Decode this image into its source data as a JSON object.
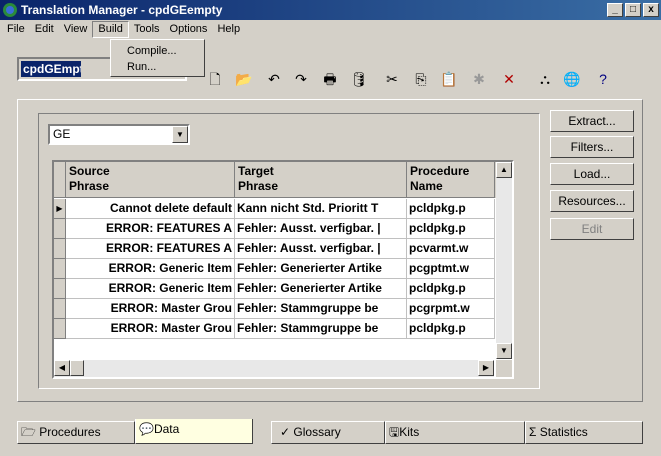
{
  "window": {
    "title": "Translation Manager - cpdGEempty"
  },
  "menu": {
    "file": "File",
    "edit": "Edit",
    "view": "View",
    "build": "Build",
    "tools": "Tools",
    "options": "Options",
    "help": "Help"
  },
  "build_menu": {
    "compile": "Compile...",
    "run": "Run..."
  },
  "toolbar": {
    "file_box": "cpdGEmpty"
  },
  "language_select": {
    "value": "GE"
  },
  "table": {
    "headers": [
      {
        "line1": "Source",
        "line2": "Phrase"
      },
      {
        "line1": "Target",
        "line2": "Phrase"
      },
      {
        "line1": "Procedure",
        "line2": "Name"
      }
    ],
    "rows": [
      {
        "source": "Cannot delete default",
        "target": "Kann nicht Std. Prioritt T",
        "proc": "pcldpkg.p"
      },
      {
        "source": "ERROR: FEATURES A",
        "target": "Fehler: Ausst. verfigbar. |",
        "proc": "pcldpkg.p"
      },
      {
        "source": "ERROR: FEATURES A",
        "target": "Fehler: Ausst. verfigbar. |",
        "proc": "pcvarmt.w"
      },
      {
        "source": "ERROR: Generic Item",
        "target": "Fehler: Generierter Artike",
        "proc": "pcgptmt.w"
      },
      {
        "source": "ERROR: Generic Item",
        "target": "Fehler: Generierter Artike",
        "proc": "pcldpkg.p"
      },
      {
        "source": "ERROR: Master Grou",
        "target": "Fehler: Stammgruppe be",
        "proc": "pcgrpmt.w"
      },
      {
        "source": "ERROR: Master Grou",
        "target": "Fehler: Stammgruppe be",
        "proc": "pcldpkg.p"
      }
    ]
  },
  "side_buttons": {
    "extract": "Extract...",
    "filters": "Filters...",
    "load": "Load...",
    "resources": "Resources...",
    "edit": "Edit"
  },
  "tabs": {
    "procedures": "Procedures",
    "data": "Data",
    "glossary": "Glossary",
    "kits": "Kits",
    "statistics": "Statistics"
  }
}
